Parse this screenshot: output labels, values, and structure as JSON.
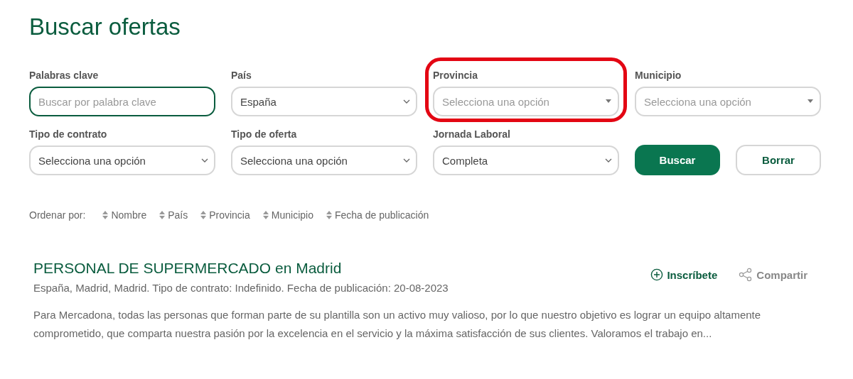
{
  "title": "Buscar ofertas",
  "fields": [
    {
      "label": "Palabras clave",
      "kind": "text",
      "placeholder": "Buscar por palabra clave",
      "focused": true,
      "disabled": false,
      "highlighted": false
    },
    {
      "label": "País",
      "kind": "select",
      "value": "España",
      "focused": false,
      "disabled": false,
      "highlighted": false
    },
    {
      "label": "Provincia",
      "kind": "select",
      "placeholder": "Selecciona una opción",
      "focused": false,
      "disabled": true,
      "highlighted": true
    },
    {
      "label": "Municipio",
      "kind": "select",
      "placeholder": "Selecciona una opción",
      "focused": false,
      "disabled": true,
      "highlighted": false
    },
    {
      "label": "Tipo de contrato",
      "kind": "select",
      "value": "Selecciona una opción",
      "focused": false,
      "disabled": false,
      "highlighted": false
    },
    {
      "label": "Tipo de oferta",
      "kind": "select",
      "value": "Selecciona una opción",
      "focused": false,
      "disabled": false,
      "highlighted": false
    },
    {
      "label": "Jornada Laboral",
      "kind": "select",
      "value": "Completa",
      "focused": false,
      "disabled": false,
      "highlighted": false
    }
  ],
  "buttons": [
    {
      "label": "Buscar",
      "kind": "primary"
    },
    {
      "label": "Borrar",
      "kind": "secondary"
    }
  ],
  "sort": {
    "label": "Ordenar por:",
    "options": [
      "Nombre",
      "País",
      "Provincia",
      "Municipio",
      "Fecha de publicación"
    ]
  },
  "offers": [
    {
      "title": "PERSONAL DE SUPERMERCADO en Madrid",
      "meta": "España, Madrid, Madrid. Tipo de contrato: Indefinido. Fecha de publicación: 20-08-2023",
      "description": "Para Mercadona, todas las personas que forman parte de su plantilla son un activo muy valioso, por lo que nuestro objetivo es lograr un equipo altamente comprometido, que comparta nuestra pasión por la excelencia en el servicio y la máxima satisfacción de sus clientes. Valoramos el trabajo en...",
      "actions": [
        {
          "label": "Inscríbete",
          "kind": "join"
        },
        {
          "label": "Compartir",
          "kind": "share"
        }
      ]
    }
  ]
}
